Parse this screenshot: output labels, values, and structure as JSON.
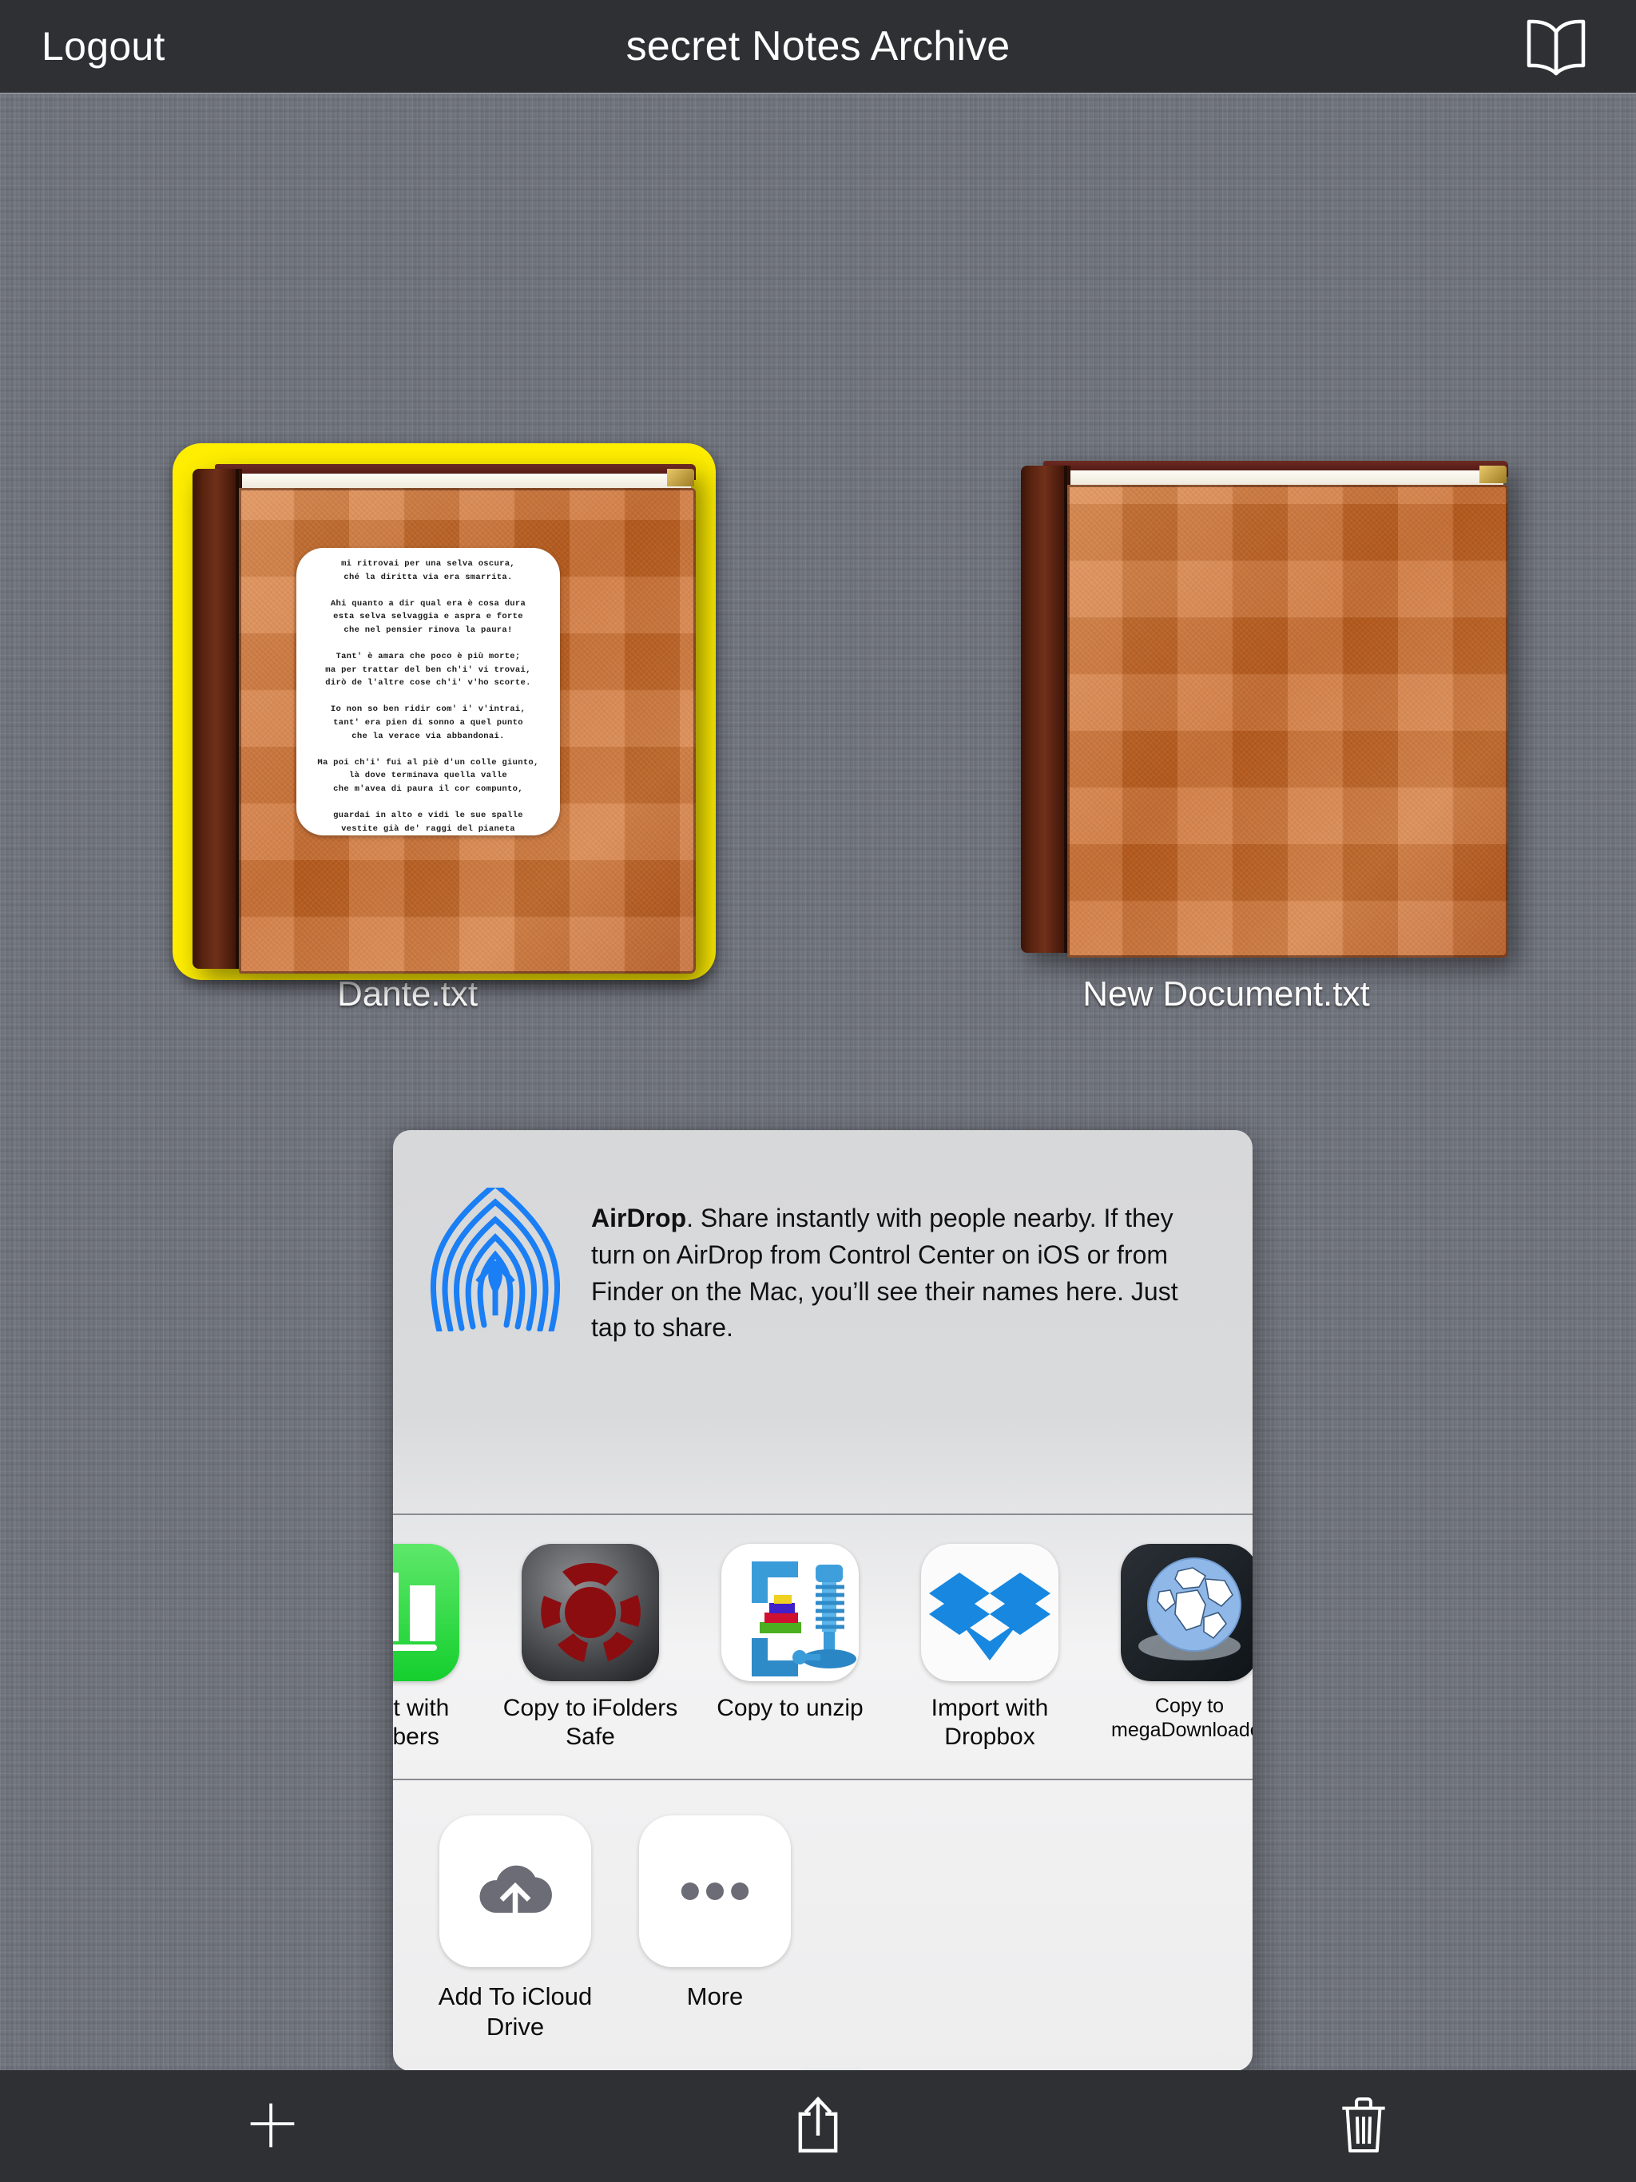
{
  "topbar": {
    "logout_label": "Logout",
    "title": "secret Notes Archive",
    "bookmark_icon": "open-book-icon",
    "background_color": "#2e3034"
  },
  "files": [
    {
      "name": "Dante.txt",
      "selected": true,
      "selection_color": "#ffee00",
      "preview_text": "mi ritrovai per una selva oscura,\nché la diritta via era smarrita.\n\nAhi quanto a dir qual era è cosa dura\nesta selva selvaggia e aspra e forte\nche nel pensier rinova la paura!\n\nTant' è amara che poco è più morte;\nma per trattar del ben ch'i' vi trovai,\ndirò de l'altre cose ch'i' v'ho scorte.\n\nIo non so ben ridir com' i' v'intrai,\ntant' era pien di sonno a quel punto\nche la verace via abbandonai.\n\nMa poi ch'i' fui al piè d'un colle giunto,\nlà dove terminava quella valle\nche m'avea di paura il cor compunto,\n\nguardai in alto e vidi le sue spalle\nvestite già de' raggi del pianeta\nche mena dritto altrui per ogne calle.\n\nAllor fu la paura un poco queta,\nche nel lago del cor m'era durata\nla notte ch'i' passai con tanta pieta.\n\nE come quei che con lena affannata,"
    },
    {
      "name": "New Document.txt",
      "selected": false,
      "preview_text": ""
    }
  ],
  "share_sheet": {
    "airdrop": {
      "icon": "airdrop-icon",
      "title": "AirDrop",
      "body": ". Share instantly with people nearby. If they turn on AirDrop from Control Center on iOS or from Finder on the Mac, you’ll see their names here. Just tap to share."
    },
    "apps": [
      {
        "label": "Import with Numbers",
        "icon": "numbers-app-icon",
        "clipped": true
      },
      {
        "label": "Copy to iFolders Safe",
        "icon": "ifolders-safe-app-icon",
        "clipped": false
      },
      {
        "label": "Copy to unzip",
        "icon": "unzip-app-icon",
        "clipped": false
      },
      {
        "label": "Import with Dropbox",
        "icon": "dropbox-app-icon",
        "clipped": false
      },
      {
        "label": "Copy to megaDownloader",
        "icon": "megadownloader-app-icon",
        "clipped": true
      }
    ],
    "actions": [
      {
        "label": "Add To iCloud Drive",
        "icon": "icloud-upload-icon"
      },
      {
        "label": "More",
        "icon": "ellipsis-icon"
      }
    ]
  },
  "toolbar": {
    "add_label": "add-icon",
    "share_label": "share-icon",
    "delete_label": "trash-icon"
  }
}
